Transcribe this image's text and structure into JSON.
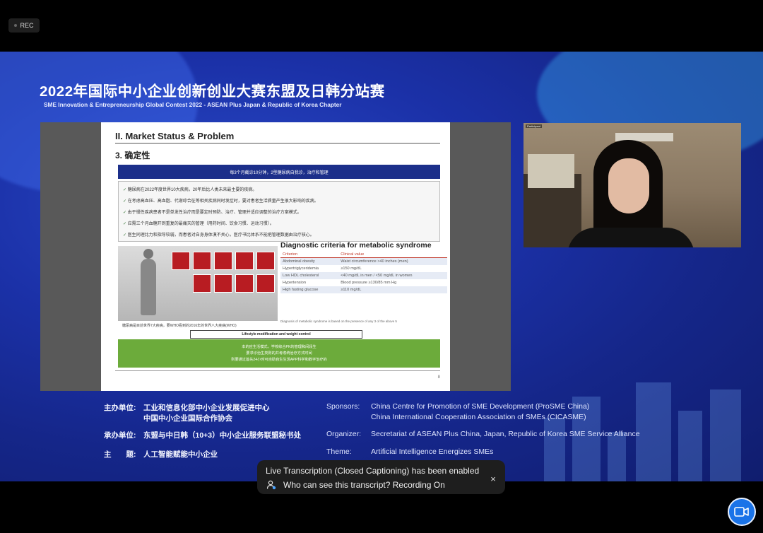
{
  "recording": {
    "badge": "REC"
  },
  "banner": {
    "title": "2022年国际中小企业创新创业大赛东盟及日韩分站赛",
    "subtitle": "SME Innovation & Entrepreneurship Global Contest 2022 - ASEAN Plus Japan & Republic of Korea Chapter"
  },
  "slide": {
    "heading": "II. Market Status & Problem",
    "subheading": "3. 确定性",
    "blue_bar": "每3个月截诊10分钟，2型糖尿病自我诊，治疗和管理",
    "bullets": [
      "糖尿病在2022年度世界10大疾病，20年后比人类未来最主要的疾病。",
      "在考虑高血压、高血脂、代谢综合征等相关疾病同时发症时，要对患者生活质量产生很大影响的疾病。",
      "由于慢性疾病患者不是单发性治疗而是要定时预防、治疗、管理并适应调整的治疗方案模式。",
      "应需三个月血糖开到重复的最痛天的管理（用药时间、饮食习惯、运动习惯）。",
      "医生同理比力和指导较弱，而患者对自身身体漠不关心，医疗书比体系不能把管理数据由治疗核心。"
    ],
    "image_caption": "糖尿病是目前世界7大疾病，要WHO看到的2016年的世界八大疾病(WHO)",
    "diagnostic_title": "Diagnostic criteria for metabolic syndrome",
    "table_headers": [
      "Criterion",
      "Clinical value"
    ],
    "table_rows": [
      [
        "Abdominal obesity",
        "Waist circumference >40 inches (men)"
      ],
      [
        "Hypertriglyceridemia",
        "≥150 mg/dL"
      ],
      [
        "Low HDL cholesterol",
        "<40 mg/dL in men / <50 mg/dL in women"
      ],
      [
        "Hypertension",
        "Blood pressure ≥130/85 mm Hg"
      ],
      [
        "High fasting glucose",
        "≥110 mg/dL"
      ]
    ],
    "table_footnote": "Diagnosis of metabolic syndrome is based on the presence of any 3 of the above 5",
    "lifestyle_box": "Lifestyle modification and weight control",
    "green_box_lines": [
      "本的应生活模式，学校综合PK的管理和间段生",
      "要求诊治生类则的并考虑统治疗方式时间",
      "则要通过首先24小时可自助自生生活APP科学和数字治疗的"
    ],
    "page_number": "8"
  },
  "video": {
    "participant_label": "Participant"
  },
  "credits": {
    "zh": {
      "sponsors_label": "主办单位:",
      "sponsors_line1": "工业和信息化部中小企业发展促进中心",
      "sponsors_line2": "中国中小企业国际合作协会",
      "organizer_label": "承办单位:",
      "organizer_value": "东盟与中日韩（10+3）中小企业服务联盟秘书处",
      "theme_label": "主　　题:",
      "theme_value": "人工智能赋能中小企业"
    },
    "en": {
      "sponsors_label": "Sponsors:",
      "sponsors_line1": "China Centre for Promotion of SME Development (ProSME China)",
      "sponsors_line2": "China International Cooperation Association of SMEs (CICASME)",
      "organizer_label": "Organizer:",
      "organizer_value": "Secretariat of ASEAN Plus China, Japan, Republic of Korea SME Service Alliance",
      "theme_label": "Theme:",
      "theme_value": "Artificial Intelligence Energizes SMEs"
    }
  },
  "caption": {
    "line1": "Live Transcription (Closed Captioning) has been enabled",
    "line2": "Who can see this transcript? Recording On",
    "close_glyph": "×"
  },
  "colors": {
    "stage_blue": "#1b31a8",
    "accent": "#1a73e8"
  }
}
